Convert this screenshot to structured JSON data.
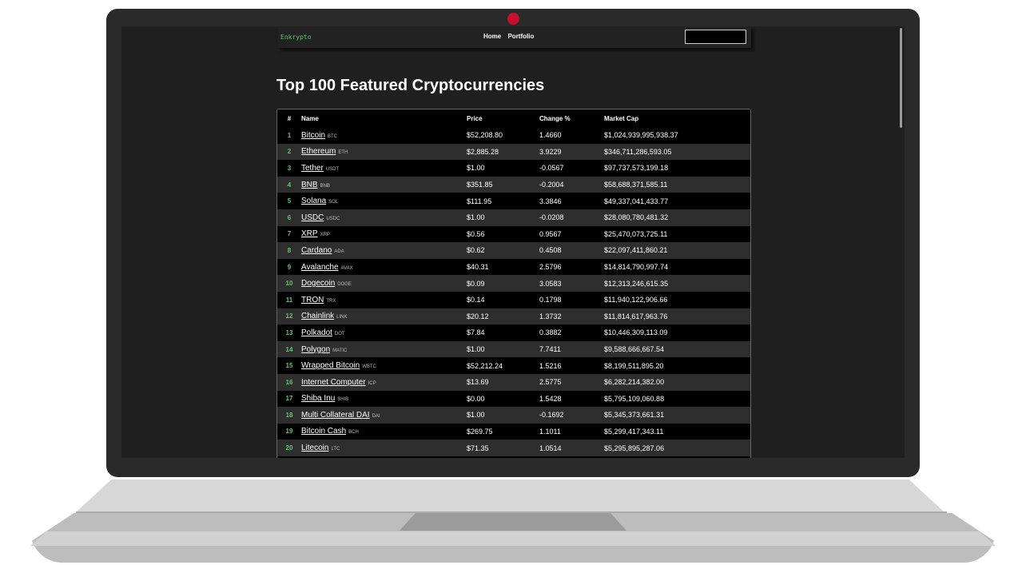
{
  "site": {
    "brand": "Enkrypto",
    "nav": [
      "Home",
      "Portfolio"
    ],
    "search_placeholder": ""
  },
  "page_title": "Top 100 Featured Cryptocurrencies",
  "table": {
    "headers": {
      "rank": "#",
      "name": "Name",
      "price": "Price",
      "change": "Change %",
      "market_cap": "Market Cap"
    },
    "rows": [
      {
        "rank": "1",
        "name": "Bitcoin",
        "symbol": "BTC",
        "price": "$52,208.80",
        "change": "1.4660",
        "market_cap": "$1,024,939,995,938.37"
      },
      {
        "rank": "2",
        "name": "Ethereum",
        "symbol": "ETH",
        "price": "$2,885.28",
        "change": "3.9229",
        "market_cap": "$346,711,286,593.05"
      },
      {
        "rank": "3",
        "name": "Tether",
        "symbol": "USDT",
        "price": "$1.00",
        "change": "-0.0567",
        "market_cap": "$97,737,573,199.18"
      },
      {
        "rank": "4",
        "name": "BNB",
        "symbol": "BNB",
        "price": "$351.85",
        "change": "-0.2004",
        "market_cap": "$58,688,371,585.11"
      },
      {
        "rank": "5",
        "name": "Solana",
        "symbol": "SOL",
        "price": "$111.95",
        "change": "3.3846",
        "market_cap": "$49,337,041,433.77"
      },
      {
        "rank": "6",
        "name": "USDC",
        "symbol": "USDC",
        "price": "$1.00",
        "change": "-0.0208",
        "market_cap": "$28,080,780,481.32"
      },
      {
        "rank": "7",
        "name": "XRP",
        "symbol": "XRP",
        "price": "$0.56",
        "change": "0.9567",
        "market_cap": "$25,470,073,725.11"
      },
      {
        "rank": "8",
        "name": "Cardano",
        "symbol": "ADA",
        "price": "$0.62",
        "change": "0.4508",
        "market_cap": "$22,097,411,860.21"
      },
      {
        "rank": "9",
        "name": "Avalanche",
        "symbol": "AVAX",
        "price": "$40.31",
        "change": "2.5796",
        "market_cap": "$14,814,790,997.74"
      },
      {
        "rank": "10",
        "name": "Dogecoin",
        "symbol": "DOGE",
        "price": "$0.09",
        "change": "3.0583",
        "market_cap": "$12,313,246,615.35"
      },
      {
        "rank": "11",
        "name": "TRON",
        "symbol": "TRX",
        "price": "$0.14",
        "change": "0.1798",
        "market_cap": "$11,940,122,906.66"
      },
      {
        "rank": "12",
        "name": "Chainlink",
        "symbol": "LINK",
        "price": "$20.12",
        "change": "1.3732",
        "market_cap": "$11,814,617,963.76"
      },
      {
        "rank": "13",
        "name": "Polkadot",
        "symbol": "DOT",
        "price": "$7.84",
        "change": "0.3882",
        "market_cap": "$10,446,309,113.09"
      },
      {
        "rank": "14",
        "name": "Polygon",
        "symbol": "MATIC",
        "price": "$1.00",
        "change": "7.7411",
        "market_cap": "$9,588,666,667.54"
      },
      {
        "rank": "15",
        "name": "Wrapped Bitcoin",
        "symbol": "WBTC",
        "price": "$52,212.24",
        "change": "1.5216",
        "market_cap": "$8,199,511,895.20"
      },
      {
        "rank": "16",
        "name": "Internet Computer",
        "symbol": "ICP",
        "price": "$13.69",
        "change": "2.5775",
        "market_cap": "$6,282,214,382.00"
      },
      {
        "rank": "17",
        "name": "Shiba Inu",
        "symbol": "SHIB",
        "price": "$0.00",
        "change": "1.5428",
        "market_cap": "$5,795,109,060.88"
      },
      {
        "rank": "18",
        "name": "Multi Collateral DAI",
        "symbol": "DAI",
        "price": "$1.00",
        "change": "-0.1692",
        "market_cap": "$5,345,373,661.31"
      },
      {
        "rank": "19",
        "name": "Bitcoin Cash",
        "symbol": "BCH",
        "price": "$269.75",
        "change": "1.1011",
        "market_cap": "$5,299,417,343.11"
      },
      {
        "rank": "20",
        "name": "Litecoin",
        "symbol": "LTC",
        "price": "$71.35",
        "change": "1.0514",
        "market_cap": "$5,295,895,287.06"
      }
    ]
  },
  "colors": {
    "brand_green": "#5fc76a",
    "camera_red": "#c8102e",
    "row_odd": "#000000",
    "row_even": "#2e2e2e"
  },
  "icons": [
    "webcam-icon"
  ]
}
